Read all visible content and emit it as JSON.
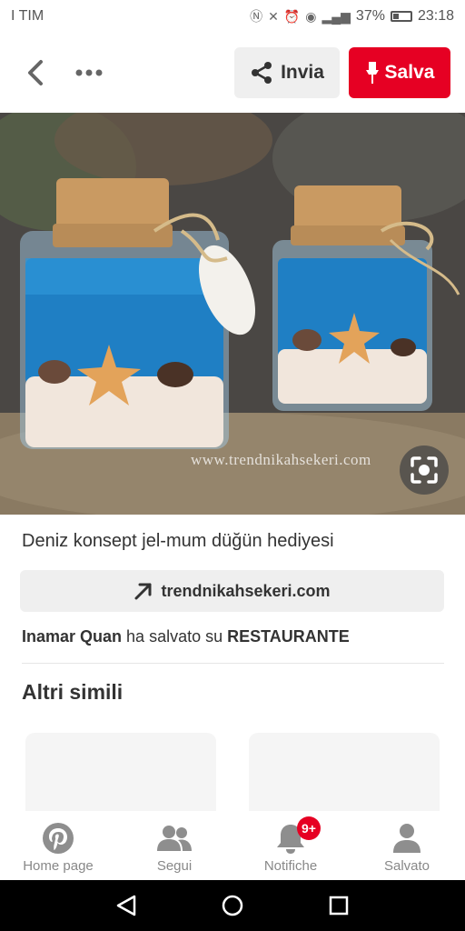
{
  "status_bar": {
    "carrier": "I TIM",
    "battery": "37%",
    "time": "23:18"
  },
  "top_bar": {
    "send_label": "Invia",
    "save_label": "Salva"
  },
  "pin": {
    "watermark": "www.trendnikahsekeri.com",
    "description": "Deniz konsept jel-mum düğün hediyesi",
    "source_link": "trendnikahsekeri.com",
    "saved_by": {
      "user": "Inamar Quan",
      "middle": "ha salvato su",
      "board": "RESTAURANTE"
    }
  },
  "similar": {
    "title": "Altri simili"
  },
  "bottom_nav": {
    "items": [
      {
        "label": "Home page",
        "icon": "pinterest-logo-icon"
      },
      {
        "label": "Segui",
        "icon": "people-icon"
      },
      {
        "label": "Notifiche",
        "icon": "bell-icon",
        "badge": "9+"
      },
      {
        "label": "Salvato",
        "icon": "person-icon"
      }
    ]
  },
  "colors": {
    "brand_red": "#e60023",
    "button_gray": "#efefef",
    "text": "#333333"
  }
}
